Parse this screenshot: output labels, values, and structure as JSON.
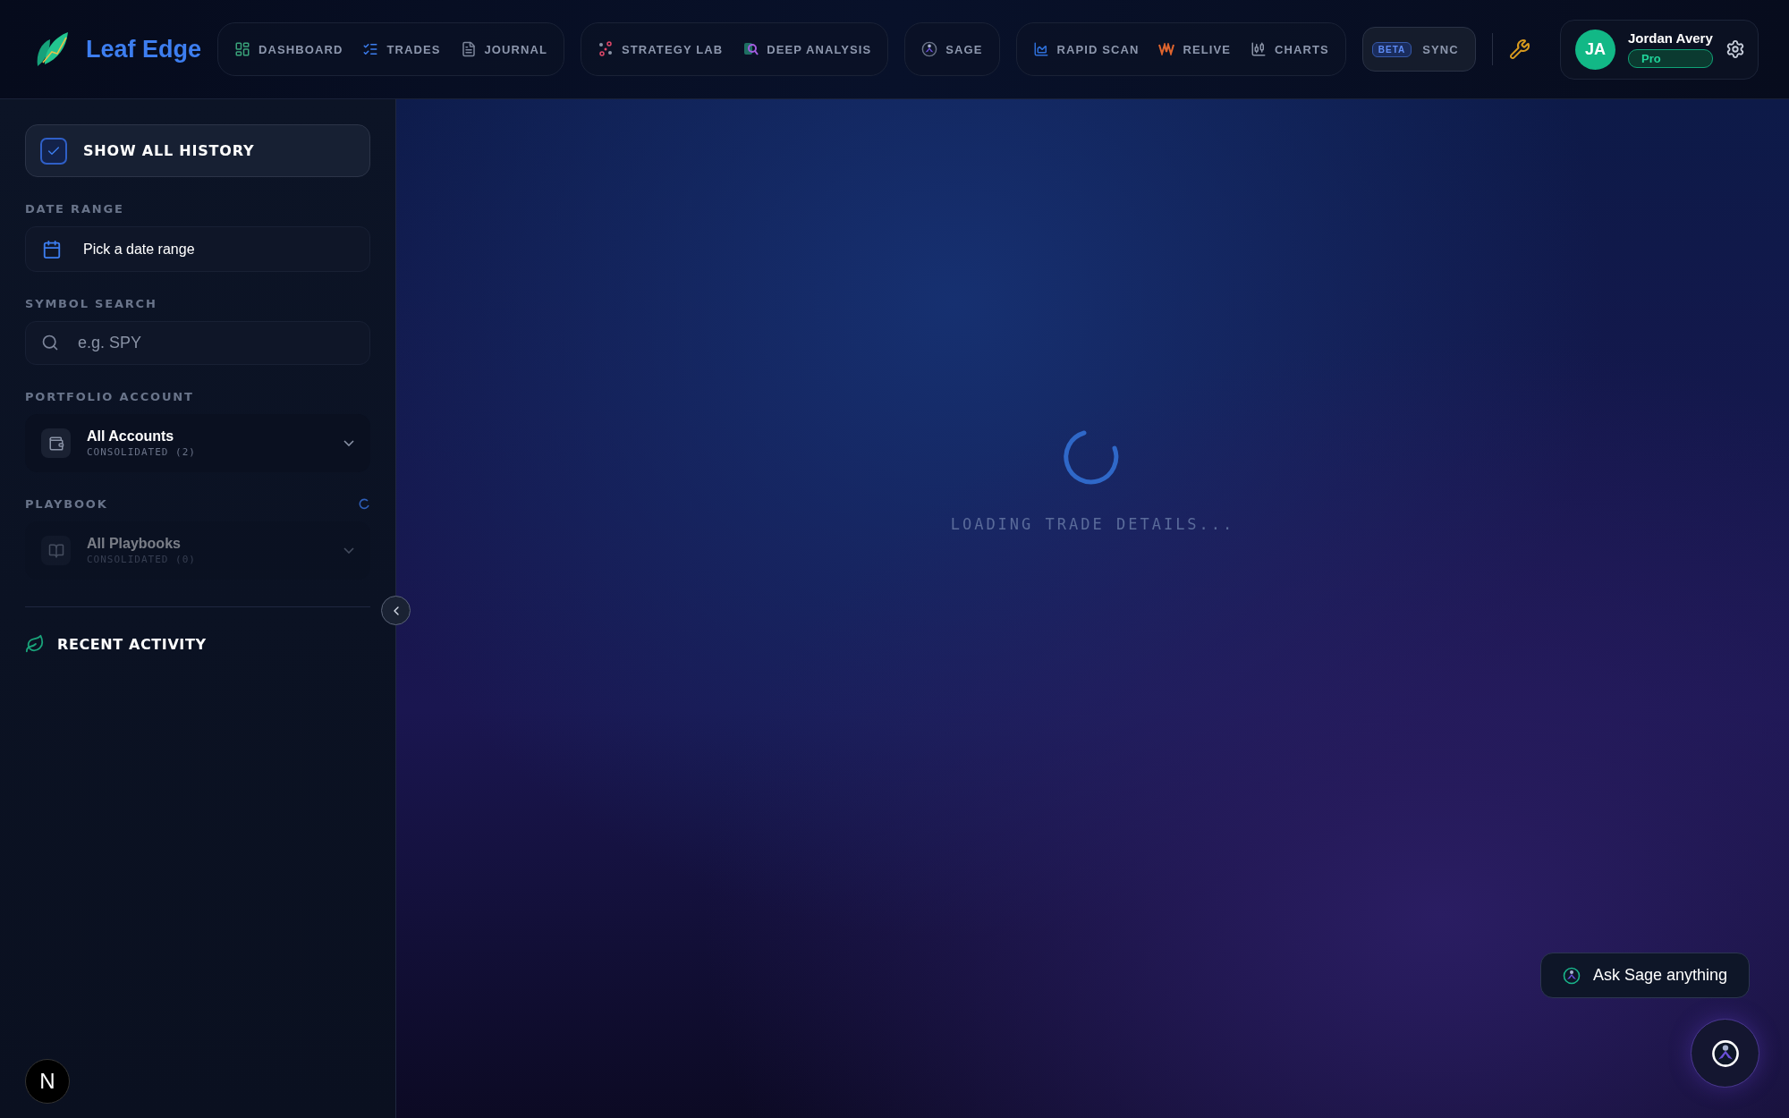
{
  "brand": {
    "name": "Leaf Edge"
  },
  "nav_groups": [
    {
      "items": [
        {
          "label": "DASHBOARD",
          "selected": false
        },
        {
          "label": "TRADES",
          "selected": false
        },
        {
          "label": "JOURNAL",
          "selected": false
        }
      ]
    },
    {
      "items": [
        {
          "label": "STRATEGY LAB",
          "selected": false
        },
        {
          "label": "DEEP ANALYSIS",
          "selected": false
        }
      ]
    },
    {
      "items": [
        {
          "label": "SAGE",
          "selected": false
        }
      ]
    },
    {
      "items": [
        {
          "label": "RAPID SCAN",
          "selected": false
        },
        {
          "label": "RELIVE",
          "selected": false
        },
        {
          "label": "CHARTS",
          "selected": false
        }
      ]
    }
  ],
  "sync_button": {
    "badge": "BETA",
    "label": "SYNC"
  },
  "user": {
    "initials": "JA",
    "name": "Jordan Avery",
    "plan": "Pro"
  },
  "sidebar": {
    "show_all_history": {
      "label": "SHOW ALL HISTORY",
      "checked": true
    },
    "date_range": {
      "label": "DATE RANGE",
      "value": "Pick a date range"
    },
    "symbol_search": {
      "label": "SYMBOL SEARCH",
      "placeholder": "e.g. SPY"
    },
    "portfolio_account": {
      "label": "PORTFOLIO ACCOUNT",
      "value": "All Accounts",
      "sub": "CONSOLIDATED (2)",
      "disabled": false
    },
    "playbook": {
      "label": "PLAYBOOK",
      "value": "All Playbooks",
      "sub": "CONSOLIDATED (0)",
      "disabled": true,
      "loading": true
    },
    "recent_activity": {
      "title": "RECENT ACTIVITY"
    }
  },
  "main": {
    "loading_text": "LOADING TRADE DETAILS..."
  },
  "ask_sage": {
    "label": "Ask Sage anything"
  },
  "dev_badge": {
    "letter": "N"
  }
}
